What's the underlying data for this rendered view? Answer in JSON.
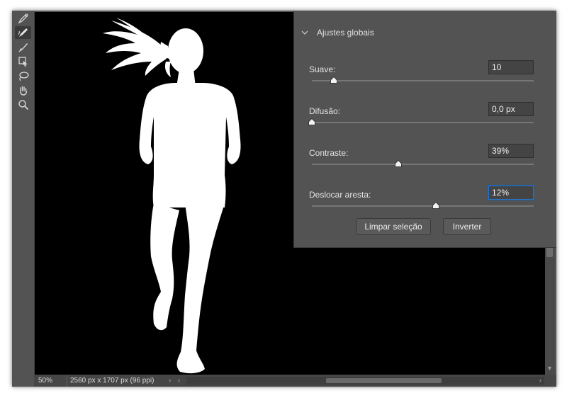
{
  "status": {
    "zoom": "50%",
    "doc_info": "2560 px x 1707 px (96 ppi)",
    "chevron": "›",
    "chevron_left": "‹",
    "chevron_right": "›"
  },
  "tools": [
    {
      "name": "quick-selection-brush-icon",
      "active": false
    },
    {
      "name": "refine-edge-brush-icon",
      "active": true
    },
    {
      "name": "brush-icon",
      "active": false
    },
    {
      "name": "object-selection-icon",
      "active": false
    },
    {
      "name": "lasso-icon",
      "active": false
    },
    {
      "name": "hand-icon",
      "active": false
    },
    {
      "name": "zoom-icon",
      "active": false
    }
  ],
  "panel": {
    "title": "Ajustes globais",
    "sliders": [
      {
        "label": "Suave:",
        "value": "10",
        "level": 0.1
      },
      {
        "label": "Difusão:",
        "value": "0,0 px",
        "level": 0.0
      },
      {
        "label": "Contraste:",
        "value": "39%",
        "level": 0.39
      },
      {
        "label": "Deslocar aresta:",
        "value": "12%",
        "level": 0.56
      }
    ],
    "buttons": {
      "clear": "Limpar seleção",
      "invert": "Inverter"
    }
  }
}
